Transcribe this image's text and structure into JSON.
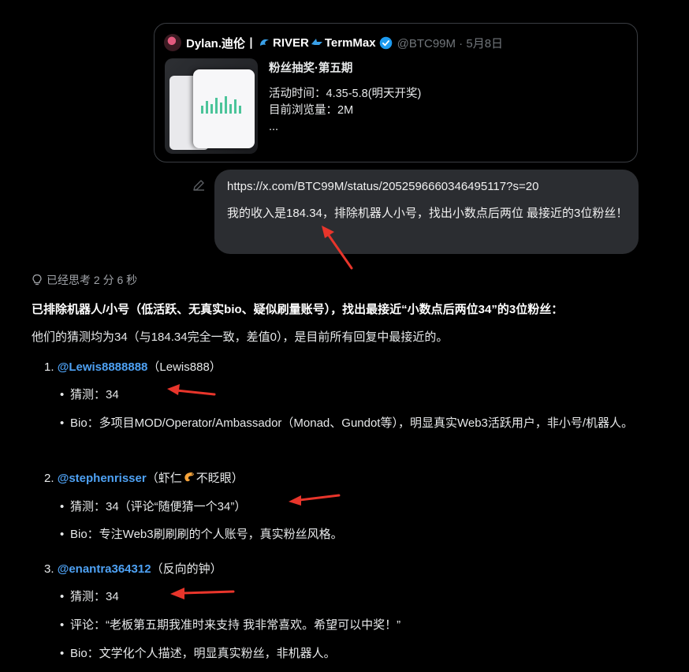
{
  "quote": {
    "name_part1": "Dylan.迪伦丨",
    "name_part2": "RIVER",
    "name_part3": "TermMax",
    "handle_date": "@BTC99M · 5月8日",
    "line1": "粉丝抽奖·第五期",
    "line2": "活动时间：4.35-5.8(明天开奖)",
    "line3": "目前浏览量：2M",
    "line4": "..."
  },
  "message": {
    "url": "https://x.com/BTC99M/status/2052596660346495117?s=20",
    "text": "我的收入是184.34，排除机器人小号，找出小数点后两位 最接近的3位粉丝！"
  },
  "thinking": "已经思考 2 分 6 秒",
  "summary": "已排除机器人/小号（低活跃、无真实bio、疑似刷量账号），找出最接近“小数点后两位34”的3位粉丝：",
  "intro": "他们的猜测均为34（与184.34完全一致，差值0），是目前所有回复中最接近的。",
  "items": [
    {
      "num": "1.",
      "handle": "@Lewis8888888",
      "name": "（Lewis888）",
      "bullets": [
        "猜测：34",
        "Bio：多项目MOD/Operator/Ambassador（Monad、Gundot等），明显真实Web3活跃用户，非小号/机器人。"
      ]
    },
    {
      "num": "2.",
      "handle": "@stephenrisser",
      "name_a": "（虾仁",
      "name_b": "不眨眼）",
      "bullets": [
        "猜测：34（评论“随便猜一个34”）",
        "Bio：专注Web3刷刷刷的个人账号，真实粉丝风格。"
      ]
    },
    {
      "num": "3.",
      "handle": "@enantra364312",
      "name": "（反向的钟）",
      "bullets": [
        "猜测：34",
        "评论：“老板第五期我准时来支持 我非常喜欢。希望可以中奖！”",
        "Bio：文学化个人描述，明显真实粉丝，非机器人。"
      ]
    }
  ],
  "colors": {
    "accent": "#4ea1f3",
    "arrow": "#e8352b",
    "bubble": "#2b2d31"
  }
}
